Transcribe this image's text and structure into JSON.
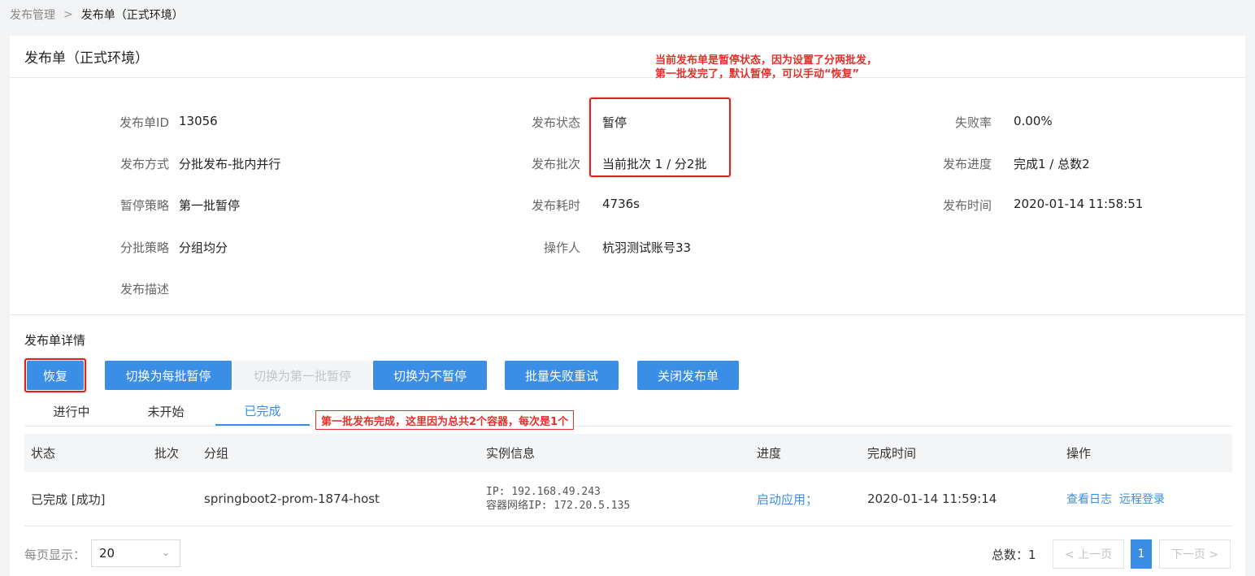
{
  "breadcrumb": {
    "root": "发布管理",
    "separator": ">",
    "current": "发布单（正式环境）"
  },
  "card": {
    "title": "发布单（正式环境）"
  },
  "annotation_top": {
    "line1": "当前发布单是暂停状态，因为设置了分两批发，",
    "line2": "第一批发完了，默认暂停，可以手动“恢复”"
  },
  "info": {
    "col1": [
      {
        "label": "发布单ID",
        "value": "13056"
      },
      {
        "label": "发布方式",
        "value": "分批发布-批内并行"
      },
      {
        "label": "暂停策略",
        "value": "第一批暂停"
      },
      {
        "label": "分批策略",
        "value": "分组均分"
      },
      {
        "label": "发布描述",
        "value": ""
      }
    ],
    "col2": [
      {
        "label": "发布状态",
        "value": "暂停"
      },
      {
        "label": "发布批次",
        "value": "当前批次 1 / 分2批"
      },
      {
        "label": "发布耗时",
        "value": "4736s"
      },
      {
        "label": "操作人",
        "value": "杭羽测试账号33"
      }
    ],
    "col3": [
      {
        "label": "失败率",
        "value": "0.00%"
      },
      {
        "label": "发布进度",
        "value": "完成1 / 总数2"
      },
      {
        "label": "发布时间",
        "value": "2020-01-14 11:58:51"
      }
    ]
  },
  "details": {
    "title": "发布单详情",
    "buttons": {
      "resume": "恢复",
      "switch_each_batch": "切换为每批暂停",
      "switch_first_batch": "切换为第一批暂停",
      "switch_no_pause": "切换为不暂停",
      "batch_retry": "批量失败重试",
      "close_order": "关闭发布单"
    },
    "tabs": [
      "进行中",
      "未开始",
      "已完成"
    ],
    "tab_note": "第一批发布完成，这里因为总共2个容器，每次是1个"
  },
  "table": {
    "headers": {
      "status": "状态",
      "batch": "批次",
      "group": "分组",
      "instance": "实例信息",
      "progress": "进度",
      "finish_time": "完成时间",
      "actions": "操作"
    },
    "rows": [
      {
        "status": "已完成 [成功]",
        "batch": "",
        "group": "springboot2-prom-1874-host",
        "ip": "IP: 192.168.49.243",
        "container_ip": "容器网络IP: 172.20.5.135",
        "progress": "启动应用；",
        "finish_time": "2020-01-14 11:59:14",
        "action_log": "查看日志",
        "action_remote": "远程登录"
      }
    ]
  },
  "footer": {
    "per_page_label": "每页显示：",
    "per_page_value": "20",
    "total_label": "总数：1",
    "prev": "< 上一页",
    "page": "1",
    "next": "下一页 >"
  }
}
